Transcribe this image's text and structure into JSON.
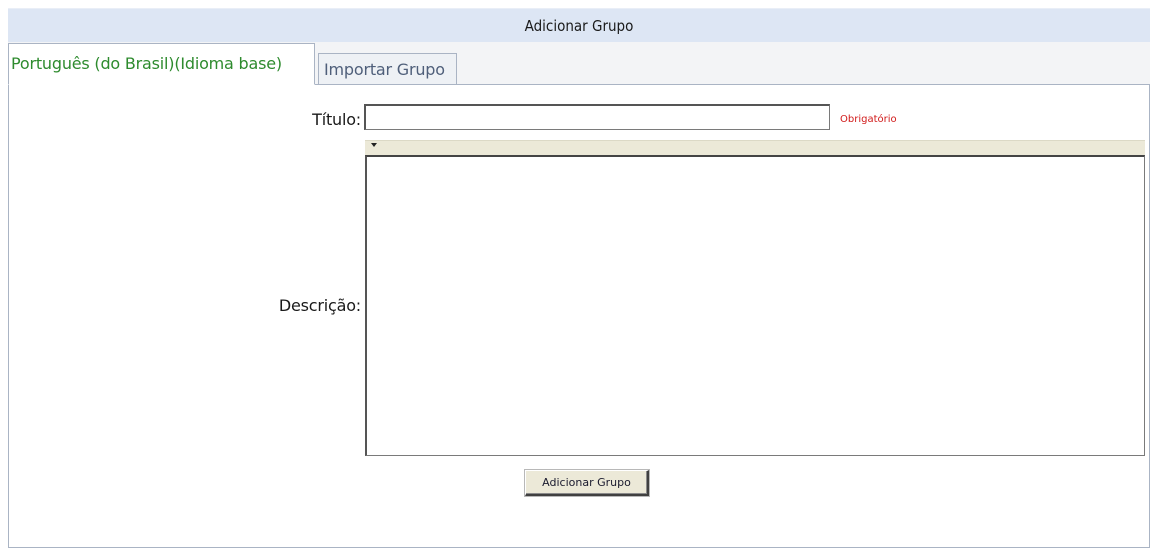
{
  "header": {
    "title": "Adicionar Grupo"
  },
  "tabs": [
    {
      "label": "Português (do Brasil)(Idioma base)",
      "active": true
    },
    {
      "label": "Importar Grupo",
      "active": false
    }
  ],
  "form": {
    "titulo_label": "Título:",
    "titulo_value": "",
    "required_note": "Obrigatório",
    "descricao_label": "Descrição:",
    "descricao_value": "",
    "submit_label": "Adicionar Grupo"
  },
  "colors": {
    "header_bg": "#dde6f4",
    "active_tab_text": "#2e8b2e",
    "inactive_tab_text": "#4f5f7a",
    "required_text": "#d11a1a",
    "editor_toolbar_bg": "#ece9d8"
  },
  "icons": {
    "toolbar_toggle": "chevron-down-icon"
  }
}
